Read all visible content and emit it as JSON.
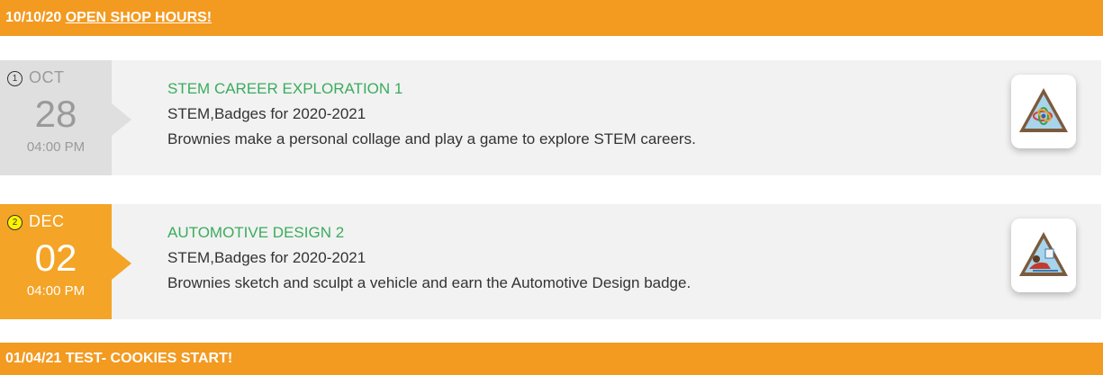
{
  "top_banner": {
    "date": "10/10/20",
    "link_text": "OPEN SHOP HOURS!"
  },
  "events": [
    {
      "number": "1",
      "month": "OCT",
      "day": "28",
      "time": "04:00 PM",
      "title": "STEM CAREER EXPLORATION 1",
      "categories": "STEM,Badges for 2020-2021",
      "description": "Brownies make a personal collage and play a game to explore STEM careers.",
      "icon": "stem-career-badge-icon"
    },
    {
      "number": "2",
      "month": "DEC",
      "day": "02",
      "time": "04:00 PM",
      "title": "AUTOMOTIVE DESIGN 2",
      "categories": "STEM,Badges for 2020-2021",
      "description": "Brownies sketch and sculpt a vehicle and earn the Automotive Design badge.",
      "icon": "automotive-design-badge-icon"
    }
  ],
  "bottom_banner": {
    "text": "01/04/21 TEST- COOKIES START!"
  },
  "colors": {
    "banner": "#f39a21",
    "title_green": "#3aac5d",
    "date_grey": "#dfdfdf",
    "date_orange": "#f4a426",
    "row_bg": "#f2f2f2"
  }
}
